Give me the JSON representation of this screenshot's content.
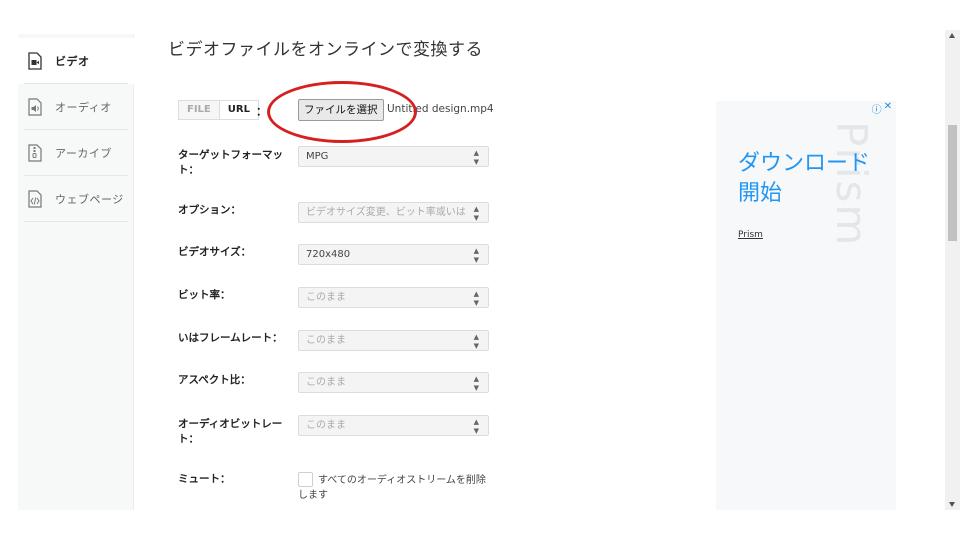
{
  "sidebar": {
    "items": [
      {
        "label": "ビデオ",
        "icon": "video-file-icon"
      },
      {
        "label": "オーディオ",
        "icon": "audio-file-icon"
      },
      {
        "label": "アーカイブ",
        "icon": "archive-file-icon"
      },
      {
        "label": "ウェブページ",
        "icon": "webpage-file-icon"
      }
    ]
  },
  "page": {
    "title": "ビデオファイルをオンラインで変換する"
  },
  "source": {
    "tab_file": "FILE",
    "tab_url": "URL",
    "colon": "：",
    "file_button": "ファイルを選択",
    "file_name": "Untitled design.mp4"
  },
  "form": {
    "target_format": {
      "label": "ターゲットフォーマット：",
      "value": "MPG"
    },
    "options": {
      "label": "オプション：",
      "value": "ビデオサイズ変更、ビット率或いは"
    },
    "video_size": {
      "label": "ビデオサイズ：",
      "value": "720x480"
    },
    "bitrate": {
      "label": "ビット率：",
      "value": "このまま"
    },
    "framerate": {
      "label": "いはフレームレート：",
      "value": "このまま"
    },
    "aspect": {
      "label": "アスペクト比：",
      "value": "このまま"
    },
    "audio_bitrate": {
      "label": "オーディオビットレート：",
      "value": "このまま"
    },
    "mute": {
      "label": "ミュート：",
      "checkbox_text": "すべてのオーディオストリームを削除します",
      "checked": false
    }
  },
  "ad": {
    "headline": "ダウンロード開始",
    "brand": "Prism",
    "watermark": "Prism",
    "info_icon": "ⓘ",
    "close_icon": "✕",
    "accent": "#2196f3"
  },
  "annotation": {
    "color": "#d42020"
  }
}
